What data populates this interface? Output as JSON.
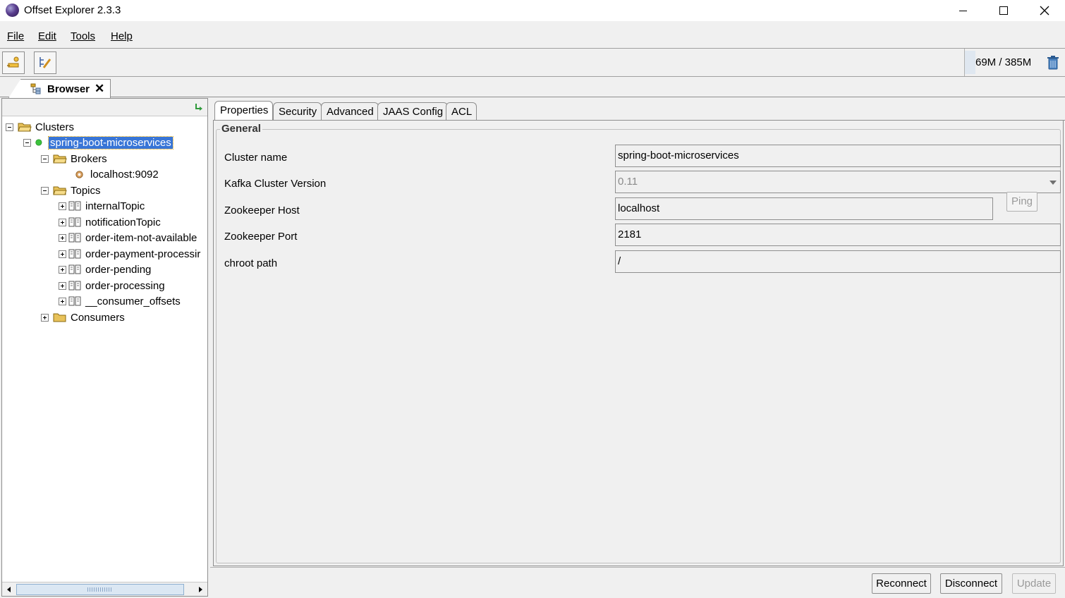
{
  "window": {
    "title": "Offset Explorer  2.3.3"
  },
  "menu": [
    "File",
    "Edit",
    "Tools",
    "Help"
  ],
  "toolbar": {
    "memory": "69M / 385M"
  },
  "tab": {
    "label": "Browser"
  },
  "tree": {
    "root": "Clusters",
    "cluster": "spring-boot-microservices",
    "brokers_label": "Brokers",
    "broker": "localhost:9092",
    "topics_label": "Topics",
    "topics": [
      "internalTopic",
      "notificationTopic",
      "order-item-not-available",
      "order-payment-processir",
      "order-pending",
      "order-processing",
      "__consumer_offsets"
    ],
    "consumers_label": "Consumers"
  },
  "properties_tabs": [
    "Properties",
    "Security",
    "Advanced",
    "JAAS Config",
    "ACL"
  ],
  "general": {
    "title": "General",
    "cluster_name_label": "Cluster name",
    "cluster_name": "spring-boot-microservices",
    "kafka_version_label": "Kafka Cluster Version",
    "kafka_version": "0.11",
    "zk_host_label": "Zookeeper Host",
    "zk_host": "localhost",
    "ping_label": "Ping",
    "zk_port_label": "Zookeeper Port",
    "zk_port": "2181",
    "chroot_label": "chroot path",
    "chroot": "/"
  },
  "actions": {
    "reconnect": "Reconnect",
    "disconnect": "Disconnect",
    "update": "Update"
  },
  "colors": {
    "selection": "#3875d7",
    "status_green": "#3cc23c",
    "folder": "#e8c25a"
  }
}
